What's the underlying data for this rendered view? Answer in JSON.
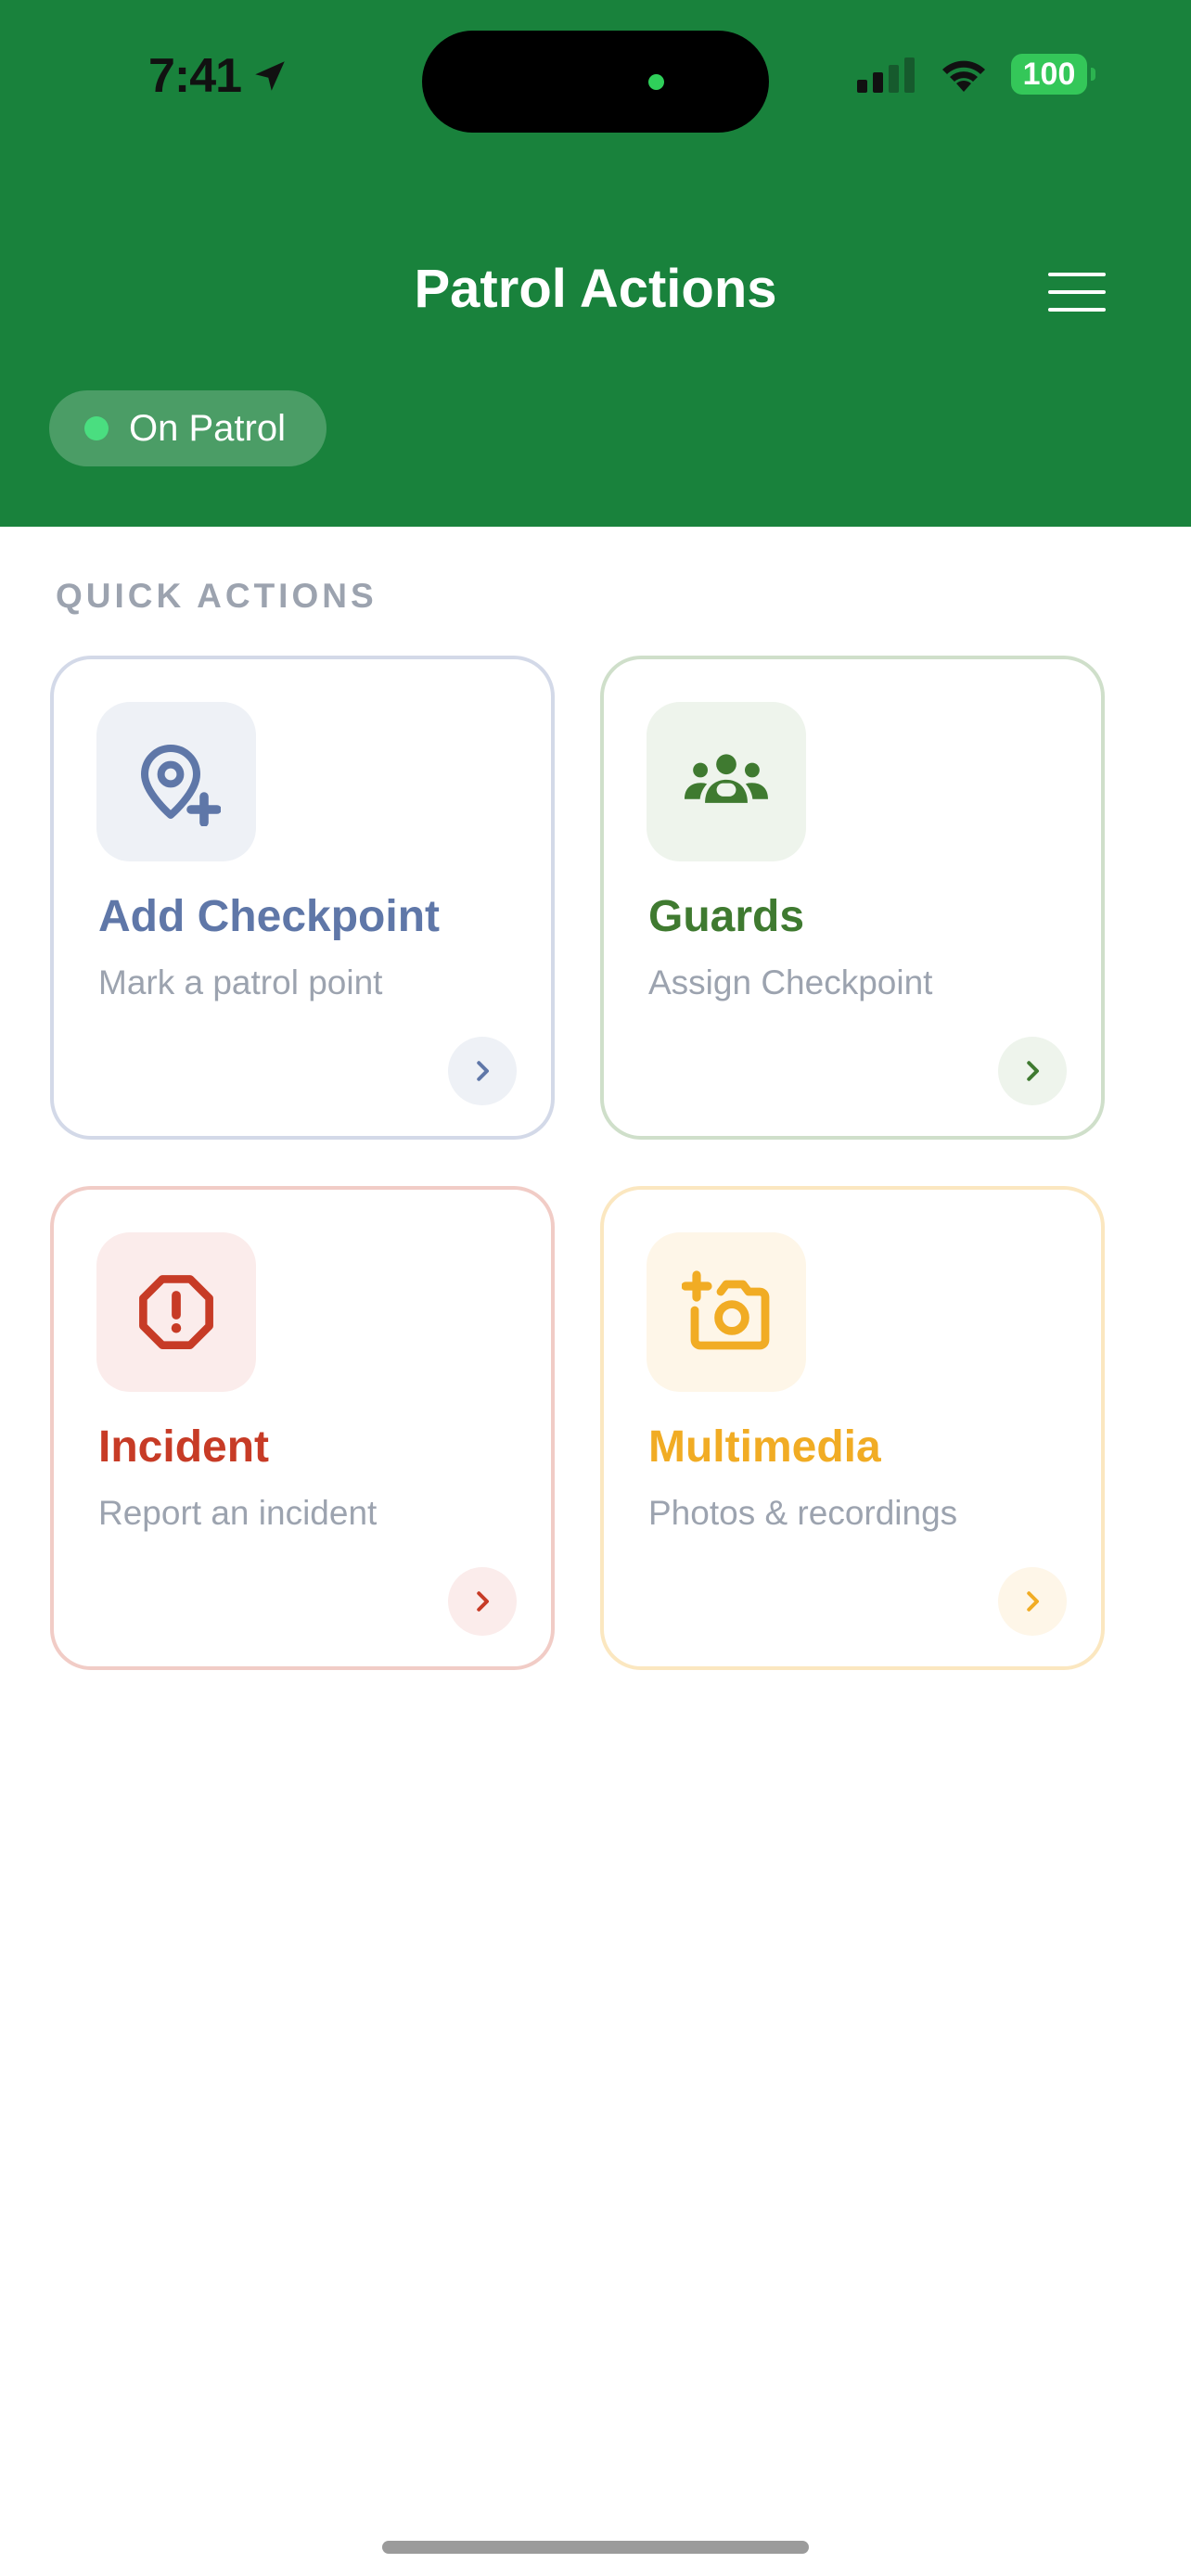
{
  "status_bar": {
    "time": "7:41",
    "battery": "100"
  },
  "header": {
    "title": "Patrol Actions",
    "status": "On Patrol"
  },
  "quick_actions": {
    "heading": "QUICK ACTIONS",
    "cards": [
      {
        "title": "Add Checkpoint",
        "subtitle": "Mark a patrol point",
        "icon": "map-pin-plus-icon",
        "accent": "#5f77a8",
        "tint": "#eef1f6",
        "border": "#d3d9e8"
      },
      {
        "title": "Guards",
        "subtitle": "Assign Checkpoint",
        "icon": "users-group-icon",
        "accent": "#3f7a30",
        "tint": "#eef4ec",
        "border": "#cfdfca"
      },
      {
        "title": "Incident",
        "subtitle": "Report an incident",
        "icon": "alert-octagon-icon",
        "accent": "#c73b26",
        "tint": "#fbeceb",
        "border": "#f1ccc6"
      },
      {
        "title": "Multimedia",
        "subtitle": "Photos & recordings",
        "icon": "camera-plus-icon",
        "accent": "#f1ac24",
        "tint": "#fef6e8",
        "border": "#fbe7c0"
      }
    ]
  }
}
